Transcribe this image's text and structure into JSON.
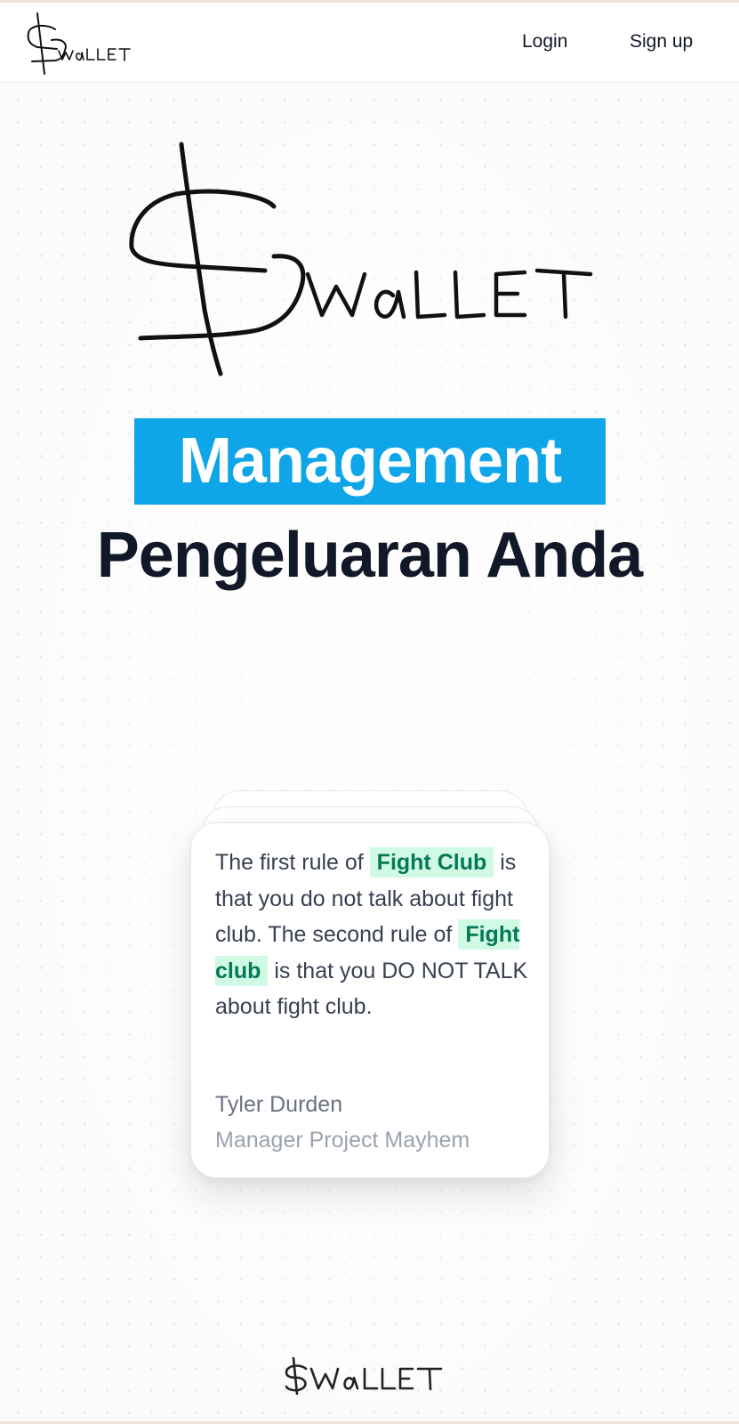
{
  "brand": {
    "logo_text": "$WaLLET"
  },
  "nav": {
    "login_label": "Login",
    "signup_label": "Sign up"
  },
  "hero": {
    "headline_highlight": "Management",
    "headline_rest": "Pengeluaran Anda",
    "accent_color": "#0ea5e9"
  },
  "testimonial": {
    "quote_part1": "The first rule of ",
    "quote_highlight1": "Fight Club",
    "quote_part2": " is that you do not talk about fight club. The second rule of ",
    "quote_highlight2": "Fight club",
    "quote_part3": " is that you DO NOT TALK about fight club.",
    "author": "Tyler Durden",
    "role": "Manager Project Mayhem",
    "highlight_bg": "#d1fae5",
    "highlight_text": "#047857"
  }
}
